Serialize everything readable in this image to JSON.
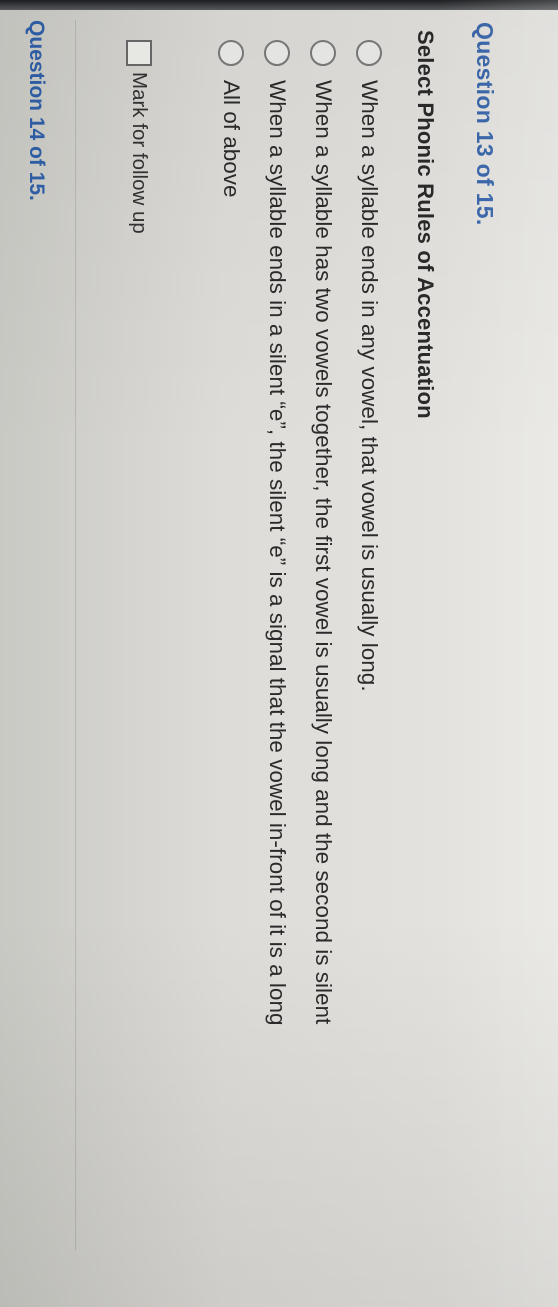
{
  "question": {
    "title": "Question 13 of 15.",
    "prompt": "Select Phonic Rules of Accentuation",
    "options": [
      {
        "label": "When a syllable ends in any vowel, that vowel is usually long.",
        "selected": false
      },
      {
        "label": "When a syllable has two vowels together, the first vowel is usually long and the second is silent",
        "selected": false
      },
      {
        "label": "When a syllable ends in a silent “e”, the silent “e” is a signal that the vowel in-front of it is a long",
        "selected": false
      },
      {
        "label": "All of above",
        "selected": false
      }
    ],
    "follow_up_label": "Mark for follow up",
    "follow_up_checked": false
  },
  "next_question": {
    "title": "Question 14 of 15."
  },
  "colors": {
    "accent": "#2f5fa8",
    "text": "#2b2b2b",
    "background": "#e6e5e1"
  }
}
